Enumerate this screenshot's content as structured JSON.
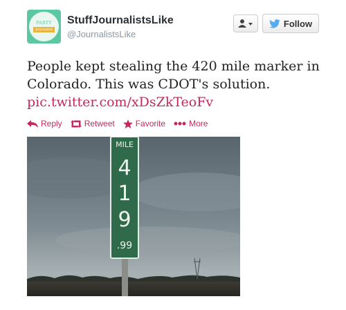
{
  "header": {
    "display_name": "StuffJournalistsLike",
    "handle": "@JournalistsLike",
    "avatar_text_top": "PARTY",
    "avatar_text_ribbon": "Journalist",
    "follow_label": "Follow"
  },
  "tweet": {
    "text": "People kept stealing the 420 mile marker in Colorado. This was CDOT's solution.",
    "link": "pic.twitter.com/xDsZkTeoFv"
  },
  "actions": [
    {
      "label": "Reply",
      "icon": "reply-icon"
    },
    {
      "label": "Retweet",
      "icon": "retweet-icon"
    },
    {
      "label": "Favorite",
      "icon": "star-icon"
    },
    {
      "label": "More",
      "icon": "more-dots-icon"
    }
  ],
  "photo": {
    "sign_word": "MILE",
    "sign_digits": [
      "4",
      "1",
      "9"
    ],
    "sign_decimal": ".99"
  },
  "colors": {
    "link": "#c4285c",
    "sign_green": "#2f6b4a",
    "sky": "#6f7c86"
  }
}
